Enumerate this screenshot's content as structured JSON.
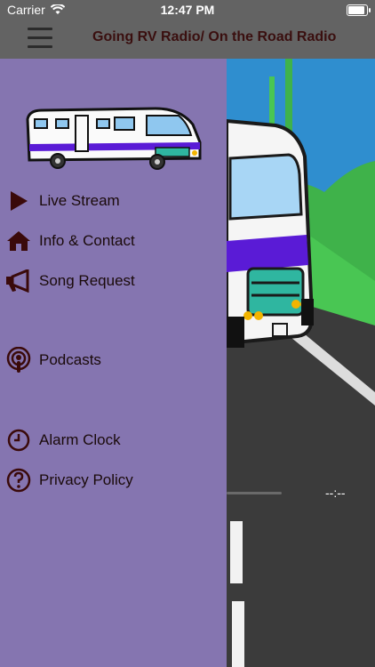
{
  "status_bar": {
    "carrier": "Carrier",
    "time": "12:47 PM"
  },
  "header": {
    "title": "Going RV Radio/ On the Road Radio",
    "menu_icon": "hamburger-icon"
  },
  "drawer": {
    "logo": "rv-logo",
    "items": [
      {
        "label": "Live Stream",
        "icon": "play-icon"
      },
      {
        "label": "Info & Contact",
        "icon": "home-icon"
      },
      {
        "label": "Song Request",
        "icon": "megaphone-icon"
      },
      {
        "label": "Podcasts",
        "icon": "podcast-icon"
      },
      {
        "label": "Alarm Clock",
        "icon": "clock-icon"
      },
      {
        "label": "Privacy Policy",
        "icon": "question-icon"
      }
    ]
  },
  "player": {
    "time_display": "--:--"
  },
  "colors": {
    "drawer_bg": "#8575b0",
    "header_bg": "#636363",
    "title_text": "#3a0f0f"
  }
}
